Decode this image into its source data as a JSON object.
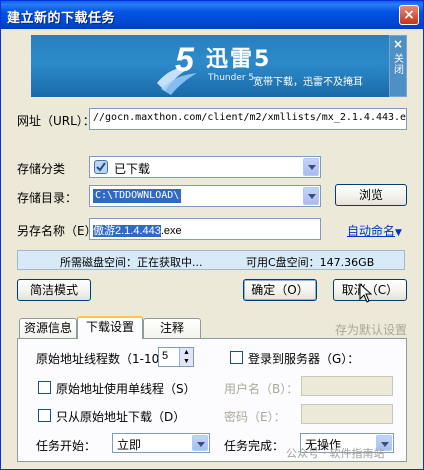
{
  "window": {
    "title": "建立新的下载任务",
    "close_label": "×"
  },
  "banner": {
    "brand": "迅雷5",
    "sub": "Thunder 5",
    "slogan": "宽带下载，迅雷不及掩耳",
    "side_close": "×",
    "side_label": "关闭"
  },
  "form": {
    "url_label": "网址（URL）：",
    "url_value": "//gocn.maxthon.com/client/m2/xmllists/mx_2.1.4.443.exe",
    "category_label": "存储分类",
    "category_value": "已下载",
    "dir_label": "存储目录：",
    "dir_value": "C:\\TDDOWNLOAD\\",
    "browse_label": "浏览",
    "saveas_label": "另存名称（E）：",
    "saveas_value_selected": "傲游2.1.4.443",
    "saveas_value_rest": ".exe",
    "auto_name_label": "自动命名"
  },
  "status": {
    "required_space": "所需磁盘空间：正在获取中...",
    "available_space": "可用C盘空间：147.36GB"
  },
  "buttons": {
    "simple_mode": "简洁模式",
    "ok": "确定（O）",
    "cancel": "取消（C）"
  },
  "tabs": [
    {
      "label": "资源信息"
    },
    {
      "label": "下载设置"
    },
    {
      "label": "注释"
    }
  ],
  "save_default_label": "存为默认设置",
  "settings": {
    "threads_label": "原始地址线程数（1-10）",
    "threads_value": "5",
    "login_label": "登录到服务器（G）：",
    "single_thread_label": "原始地址使用单线程（S）",
    "username_label": "用户名（B）：",
    "only_original_label": "只从原始地址下载（D）",
    "password_label": "密码（E）：",
    "start_label": "任务开始：",
    "start_value": "立即",
    "finish_label": "任务完成：",
    "finish_value": "无操作"
  },
  "watermark": "公众号 · 软件指南站",
  "colors": {
    "titlebar": "#0054e3",
    "banner": "#2a7fbe",
    "link": "#0033cc",
    "tab_highlight": "#ffc83c"
  }
}
